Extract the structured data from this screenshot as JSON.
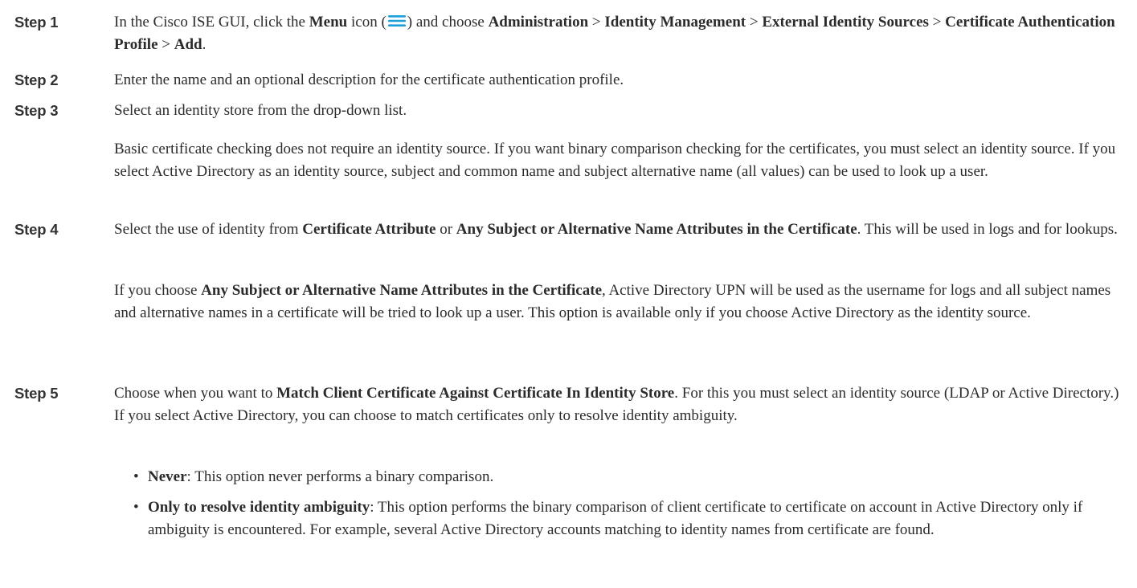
{
  "steps": [
    {
      "label": "Step 1",
      "parts": {
        "a": "In the Cisco ISE GUI, click the ",
        "menu": "Menu",
        "b": " icon (",
        "c": ") and choose ",
        "admin": "Administration",
        "sep1": " > ",
        "idm": "Identity Management",
        "sep2": " > ",
        "ext": "External Identity Sources",
        "sep3": " > ",
        "cap": "Certificate Authentication Profile",
        "sep4": " > ",
        "add": "Add",
        "end": "."
      }
    },
    {
      "label": "Step 2",
      "text": "Enter the name and an optional description for the certificate authentication profile."
    },
    {
      "label": "Step 3",
      "text": "Select an identity store from the drop-down list.",
      "note": "Basic certificate checking does not require an identity source. If you want binary comparison checking for the certificates, you must select an identity source. If you select Active Directory as an identity source, subject and common name and subject alternative name (all values) can be used to look up a user."
    },
    {
      "label": "Step 4",
      "parts": {
        "a": "Select the use of identity from ",
        "attr": "Certificate Attribute",
        "b": " or ",
        "any": "Any Subject or Alternative Name Attributes in the Certificate",
        "c": ". This will be used in logs and for lookups."
      },
      "note_parts": {
        "a": "If you choose ",
        "any": "Any Subject or Alternative Name Attributes in the Certificate",
        "b": ", Active Directory UPN will be used as the username for logs and all subject names and alternative names in a certificate will be tried to look up a user. This option is available only if you choose Active Directory as the identity source."
      }
    },
    {
      "label": "Step 5",
      "parts": {
        "a": "Choose when you want to ",
        "match": "Match Client Certificate Against Certificate In Identity Store",
        "b": ". For this you must select an identity source (LDAP or Active Directory.) If you select Active Directory, you can choose to match certificates only to resolve identity ambiguity."
      },
      "bullets": [
        {
          "term": "Never",
          "desc": ": This option never performs a binary comparison."
        },
        {
          "term": "Only to resolve identity ambiguity",
          "desc": ": This option performs the binary comparison of client certificate to certificate on account in Active Directory only if ambiguity is encountered. For example, several Active Directory accounts matching to identity names from certificate are found."
        }
      ]
    }
  ],
  "icons": {
    "menu_icon": "hamburger-menu-icon",
    "menu_icon_color": "#1a9fd9",
    "bullet": "•"
  }
}
